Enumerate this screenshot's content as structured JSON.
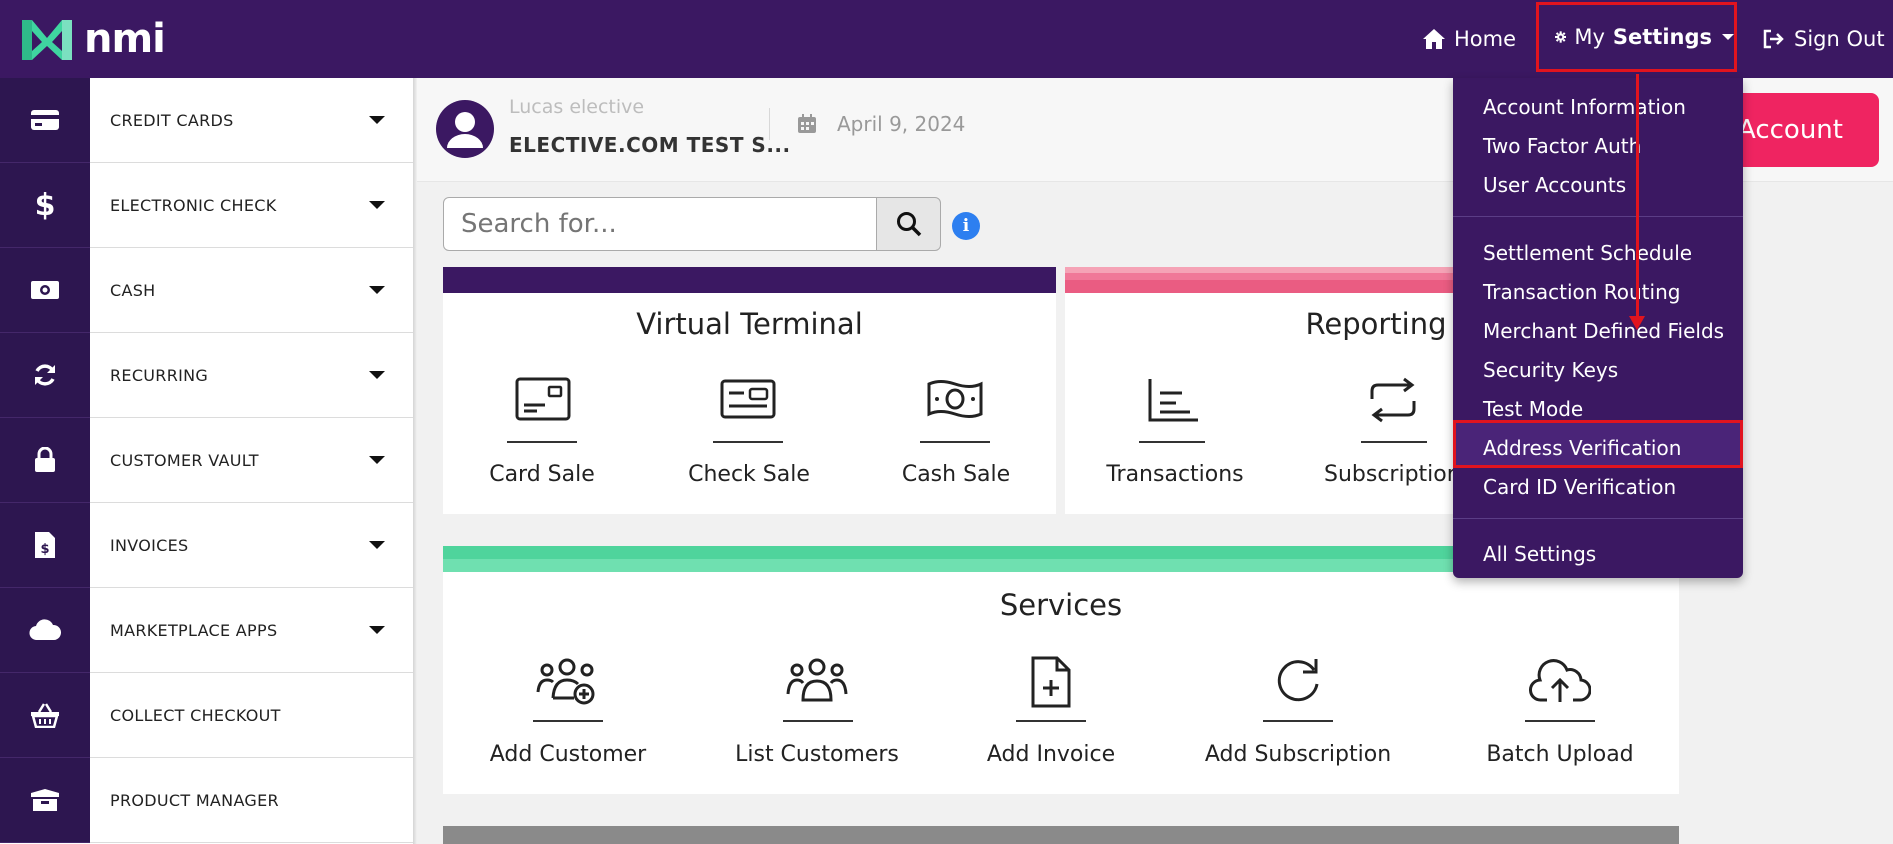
{
  "brand": {
    "logo_text": "nmi"
  },
  "topnav": {
    "home": "Home",
    "my": "My",
    "settings": "Settings",
    "sign_out": "Sign Out"
  },
  "sidebar": {
    "items": [
      {
        "label": "CREDIT CARDS",
        "icon": "credit-card-icon"
      },
      {
        "label": "ELECTRONIC CHECK",
        "icon": "dollar-icon"
      },
      {
        "label": "CASH",
        "icon": "cash-icon"
      },
      {
        "label": "RECURRING",
        "icon": "refresh-icon"
      },
      {
        "label": "CUSTOMER VAULT",
        "icon": "lock-icon"
      },
      {
        "label": "INVOICES",
        "icon": "invoice-icon"
      },
      {
        "label": "MARKETPLACE APPS",
        "icon": "cloud-icon"
      },
      {
        "label": "COLLECT CHECKOUT",
        "icon": "basket-icon"
      },
      {
        "label": "PRODUCT MANAGER",
        "icon": "box-icon"
      }
    ]
  },
  "header": {
    "user_name": "Lucas elective",
    "merchant": "ELECTIVE.COM TEST S...",
    "date": "April 9, 2024",
    "account_button": "Account"
  },
  "search": {
    "placeholder": "Search for..."
  },
  "cards": {
    "virtual_terminal": {
      "title": "Virtual Terminal",
      "color": "#3b1862",
      "tiles": [
        "Card Sale",
        "Check Sale",
        "Cash Sale"
      ]
    },
    "reporting": {
      "title": "Reporting",
      "color": "#f06a8a",
      "tiles": [
        "Transactions",
        "Subscriptions"
      ]
    },
    "services": {
      "title": "Services",
      "color": "#4fd49c",
      "tiles": [
        "Add Customer",
        "List Customers",
        "Add Invoice",
        "Add Subscription",
        "Batch Upload"
      ]
    }
  },
  "settings_menu": {
    "group1": [
      "Account Information",
      "Two Factor Auth",
      "User Accounts"
    ],
    "group2": [
      "Settlement Schedule",
      "Transaction Routing",
      "Merchant Defined Fields",
      "Security Keys",
      "Test Mode",
      "Address Verification",
      "Card ID Verification"
    ],
    "group3": [
      "All Settings"
    ],
    "highlighted": "Security Keys"
  },
  "colors": {
    "topbar": "#3b1862",
    "highlight": "#e1141e",
    "account_button": "#ef2461"
  }
}
